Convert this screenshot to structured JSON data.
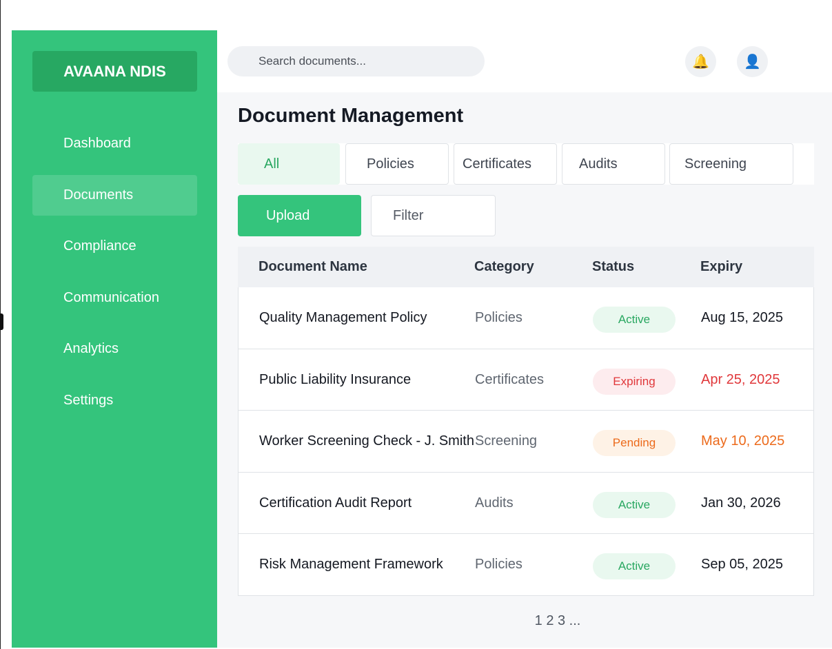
{
  "app": {
    "brand": "AVAANA NDIS"
  },
  "sidebar": {
    "items": [
      {
        "label": "Dashboard",
        "active": false
      },
      {
        "label": "Documents",
        "active": true
      },
      {
        "label": "Compliance",
        "active": false
      },
      {
        "label": "Communication",
        "active": false
      },
      {
        "label": "Analytics",
        "active": false
      },
      {
        "label": "Settings",
        "active": false
      }
    ]
  },
  "topbar": {
    "search_placeholder": "Search documents...",
    "notification_icon": "🔔",
    "user_icon": "👤"
  },
  "main": {
    "title": "Document Management",
    "tabs": [
      {
        "label": "All",
        "active": true
      },
      {
        "label": "Policies",
        "active": false
      },
      {
        "label": "Certificates",
        "active": false
      },
      {
        "label": "Audits",
        "active": false
      },
      {
        "label": "Screening",
        "active": false
      }
    ],
    "actions": {
      "upload_label": "Upload",
      "filter_label": "Filter"
    },
    "table": {
      "headers": [
        "Document Name",
        "Category",
        "Status",
        "Expiry"
      ],
      "rows": [
        {
          "name": "Quality Management Policy",
          "category": "Policies",
          "status": "Active",
          "expiry": "Aug 15, 2025",
          "tone": "active"
        },
        {
          "name": "Public Liability Insurance",
          "category": "Certificates",
          "status": "Expiring",
          "expiry": "Apr 25, 2025",
          "tone": "expiring"
        },
        {
          "name": "Worker Screening Check - J. Smith",
          "category": "Screening",
          "status": "Pending",
          "expiry": "May 10, 2025",
          "tone": "pending"
        },
        {
          "name": "Certification Audit Report",
          "category": "Audits",
          "status": "Active",
          "expiry": "Jan 30, 2026",
          "tone": "active"
        },
        {
          "name": "Risk Management Framework",
          "category": "Policies",
          "status": "Active",
          "expiry": "Sep 05, 2025",
          "tone": "active"
        }
      ]
    },
    "pagination": "1 2 3 ..."
  },
  "colors": {
    "brand_green": "#34c47c",
    "brand_green_dark": "#27a862",
    "active_text": "#28a760",
    "active_bg": "#e9f8ef",
    "expiring_text": "#e0373a",
    "expiring_bg": "#fdecee",
    "pending_text": "#ec6a1b",
    "pending_bg": "#fef2e6"
  }
}
